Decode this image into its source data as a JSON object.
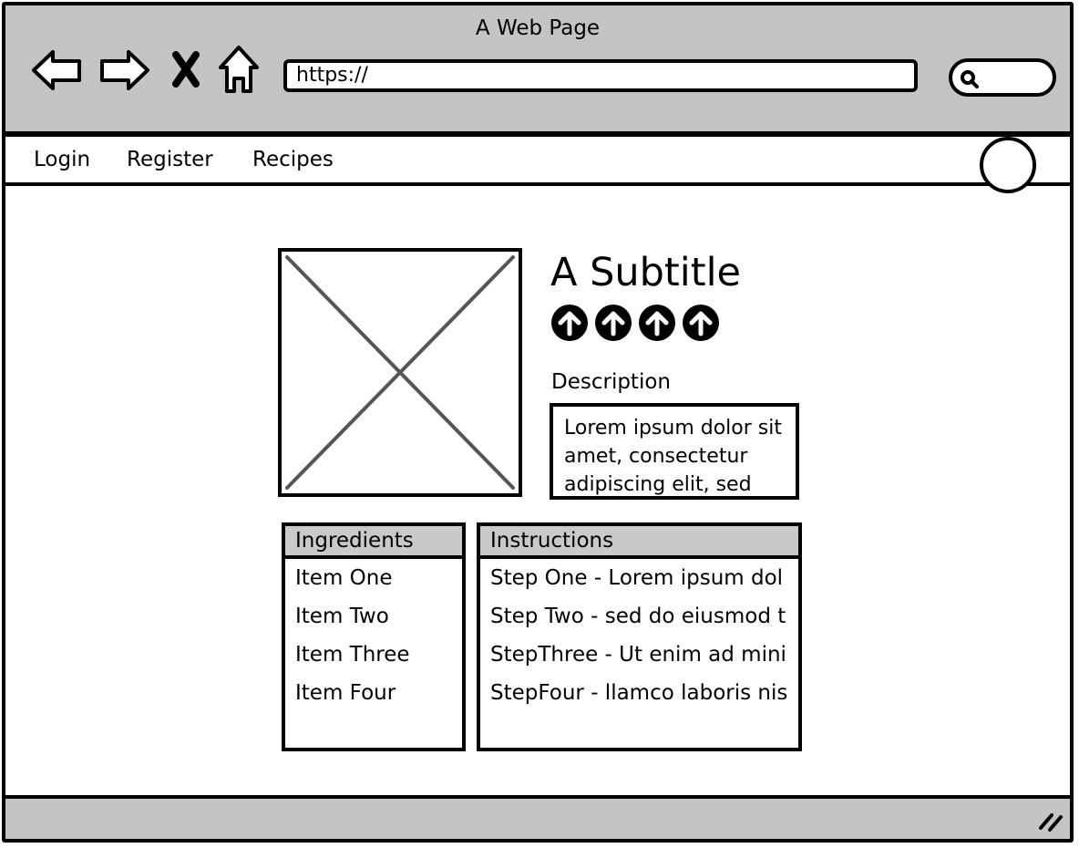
{
  "window": {
    "title": "A Web Page"
  },
  "browser": {
    "url": "https://",
    "icons": [
      "back-icon",
      "forward-icon",
      "close-icon",
      "home-icon",
      "search-icon"
    ]
  },
  "menu": {
    "items": [
      {
        "label": "Login"
      },
      {
        "label": "Register"
      },
      {
        "label": "Recipes"
      }
    ]
  },
  "recipe": {
    "subtitle": "A Subtitle",
    "rating": {
      "count": 4,
      "icon": "arrow-up-circle-icon"
    },
    "description_label": "Description",
    "description": "Lorem ipsum dolor sit amet, consectetur adipiscing elit, sed"
  },
  "ingredients": {
    "header": "Ingredients",
    "items": [
      "Item One",
      "Item Two",
      "Item Three",
      "Item Four"
    ]
  },
  "instructions": {
    "header": "Instructions",
    "steps": [
      "Step One - Lorem ipsum dol",
      "Step Two - sed do eiusmod t",
      "StepThree - Ut enim ad mini",
      "StepFour - llamco laboris nis"
    ]
  },
  "colors": {
    "chrome": "#c4c4c4",
    "header": "#c9c9c9",
    "stroke": "#000000",
    "placeholder": "#555555"
  }
}
